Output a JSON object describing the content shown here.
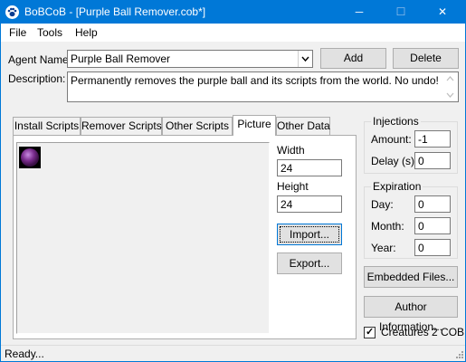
{
  "window": {
    "title": "BoBCoB - [Purple Ball Remover.cob*]",
    "minimize_glyph": "─",
    "maximize_glyph": "☐",
    "close_glyph": "✕"
  },
  "menu": {
    "file": "File",
    "tools": "Tools",
    "help": "Help"
  },
  "agent": {
    "name_label": "Agent Name:",
    "name_value": "Purple Ball Remover",
    "description_label": "Description:",
    "description_value": "Permanently removes the purple ball and its scripts from the world.  No undo!",
    "add_button": "Add",
    "delete_button": "Delete"
  },
  "tabs": [
    {
      "label": "Install Scripts"
    },
    {
      "label": "Remover Scripts"
    },
    {
      "label": "Other Scripts"
    },
    {
      "label": "Picture",
      "active": true
    },
    {
      "label": "Other Data"
    }
  ],
  "picture": {
    "width_label": "Width",
    "width_value": "24",
    "height_label": "Height",
    "height_value": "24",
    "import_button": "Import...",
    "export_button": "Export..."
  },
  "injections": {
    "title": "Injections",
    "amount_label": "Amount:",
    "amount_value": "-1",
    "delay_label": "Delay (s):",
    "delay_value": "0"
  },
  "expiration": {
    "title": "Expiration",
    "day_label": "Day:",
    "day_value": "0",
    "month_label": "Month:",
    "month_value": "0",
    "year_label": "Year:",
    "year_value": "0"
  },
  "buttons": {
    "embedded_files": "Embedded Files...",
    "author_information": "Author Information..."
  },
  "creatures2cob": {
    "label": "Creatures 2 COB",
    "checked": true,
    "check_glyph": "✓"
  },
  "status": {
    "text": "Ready..."
  },
  "colors": {
    "titlebar": "#0078d7",
    "ball": "#7b2d8e"
  },
  "icons": {
    "app": "paw-icon",
    "combo": "chevron-down-icon",
    "scroll_up": "arrow-up-icon",
    "scroll_down": "arrow-down-icon"
  }
}
